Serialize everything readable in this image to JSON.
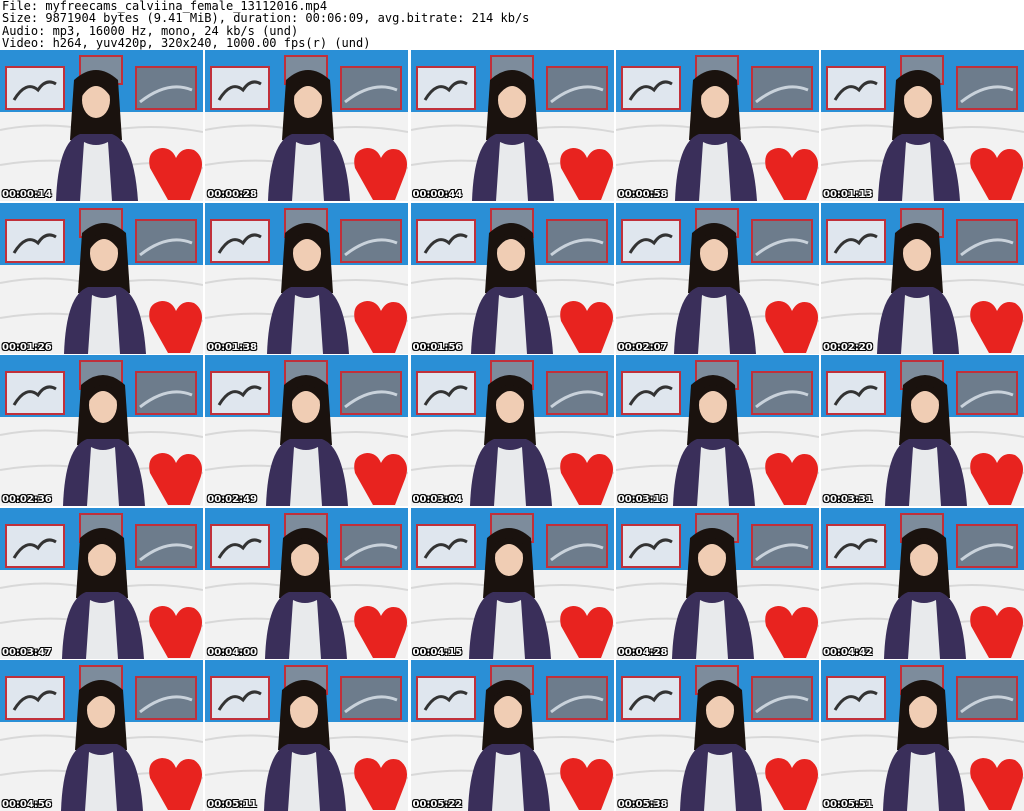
{
  "header": {
    "file": "File: myfreecams_calviina_female_13112016.mp4",
    "size": "Size: 9871904 bytes (9.41 MiB), duration: 00:06:09, avg.bitrate: 214 kb/s",
    "audio": "Audio: mp3, 16000 Hz, mono, 24 kb/s (und)",
    "video": "Video: h264, yuv420p, 320x240, 1000.00 fps(r) (und)"
  },
  "colors": {
    "wall": "#2a8fd6",
    "sofa": "#f2f2f2",
    "heart": "#e8231f",
    "shirt": "#3a2f5a",
    "hair": "#1a120e",
    "frame": "#c0303a"
  },
  "thumbnails": [
    {
      "timestamp": "00:00:14"
    },
    {
      "timestamp": "00:00:28"
    },
    {
      "timestamp": "00:00:44"
    },
    {
      "timestamp": "00:00:58"
    },
    {
      "timestamp": "00:01:13"
    },
    {
      "timestamp": "00:01:26"
    },
    {
      "timestamp": "00:01:38"
    },
    {
      "timestamp": "00:01:56"
    },
    {
      "timestamp": "00:02:07"
    },
    {
      "timestamp": "00:02:20"
    },
    {
      "timestamp": "00:02:36"
    },
    {
      "timestamp": "00:02:49"
    },
    {
      "timestamp": "00:03:04"
    },
    {
      "timestamp": "00:03:18"
    },
    {
      "timestamp": "00:03:31"
    },
    {
      "timestamp": "00:03:47"
    },
    {
      "timestamp": "00:04:00"
    },
    {
      "timestamp": "00:04:15"
    },
    {
      "timestamp": "00:04:28"
    },
    {
      "timestamp": "00:04:42"
    },
    {
      "timestamp": "00:04:56"
    },
    {
      "timestamp": "00:05:11"
    },
    {
      "timestamp": "00:05:22"
    },
    {
      "timestamp": "00:05:38"
    },
    {
      "timestamp": "00:05:51"
    }
  ]
}
